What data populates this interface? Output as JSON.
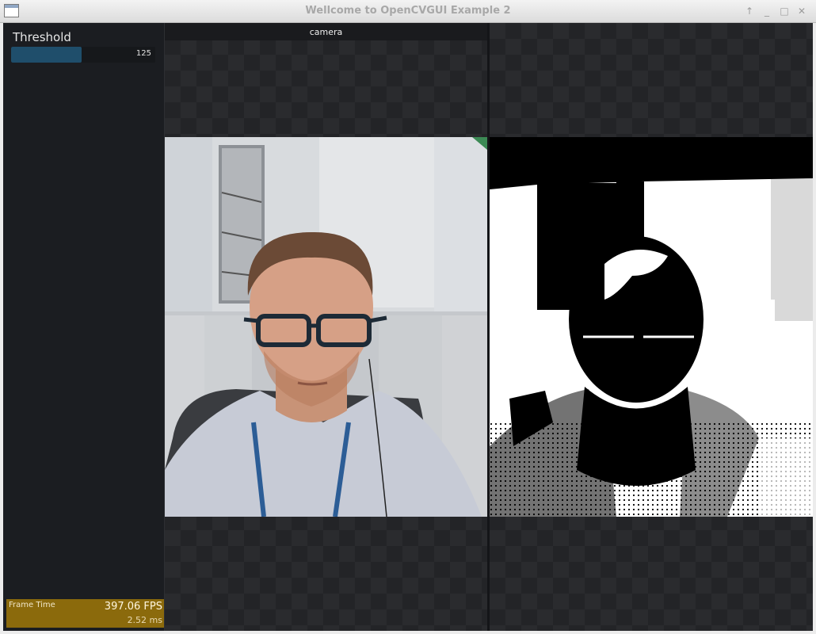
{
  "window": {
    "title": "Wellcome to OpenCVGUI Example 2",
    "buttons": [
      "↑",
      "_",
      "□",
      "✕"
    ]
  },
  "sidebar": {
    "threshold": {
      "label": "Threshold",
      "value": "125",
      "fill_fraction": 0.49
    },
    "frame_time": {
      "label": "Frame Time",
      "fps": "397.06 FPS",
      "ms": "2.52 ms"
    }
  },
  "views": {
    "left": {
      "title": "camera"
    }
  },
  "colors": {
    "accent": "#1f4e6b",
    "frame_box": "#8b6a0c",
    "background": "#1e1f22"
  }
}
